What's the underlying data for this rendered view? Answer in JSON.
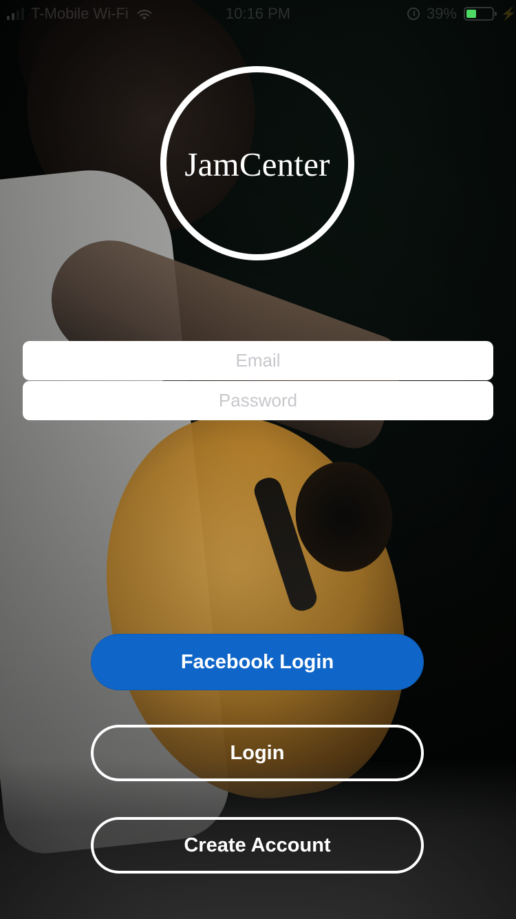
{
  "status_bar": {
    "carrier": "T-Mobile Wi-Fi",
    "time": "10:16 PM",
    "battery_percent_text": "39%",
    "battery_level": 0.39,
    "battery_color": "#4cd964"
  },
  "logo": {
    "text": "JamCenter"
  },
  "form": {
    "email_placeholder": "Email",
    "password_placeholder": "Password"
  },
  "buttons": {
    "facebook_login": "Facebook Login",
    "login": "Login",
    "create_account": "Create Account"
  },
  "colors": {
    "facebook_blue": "#0f66c8",
    "white": "#ffffff"
  },
  "icons": {
    "signal": "signal-icon",
    "wifi": "wifi-icon",
    "alarm": "alarm-icon",
    "battery": "battery-icon",
    "charging": "charging-icon"
  }
}
